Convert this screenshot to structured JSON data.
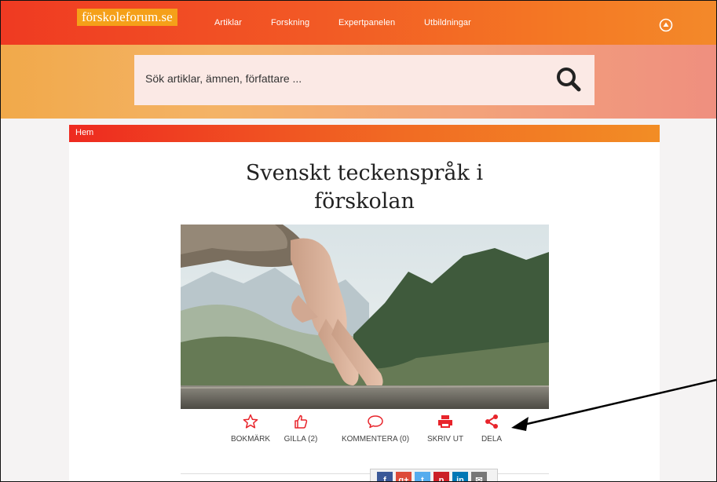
{
  "header": {
    "logo": "förskoleforum.se",
    "nav": [
      "Artiklar",
      "Forskning",
      "Expertpanelen",
      "Utbildningar"
    ]
  },
  "search": {
    "placeholder": "Sök artiklar, ämnen, författare ..."
  },
  "breadcrumb": "Hem",
  "article": {
    "title_line1": "Svenskt teckenspråk i",
    "title_line2": "förskolan"
  },
  "actions": [
    {
      "label": "BOKMÄRK",
      "icon": "star-icon"
    },
    {
      "label": "GILLA (2)",
      "icon": "thumbs-up-icon"
    },
    {
      "label": "KOMMENTERA (0)",
      "icon": "comment-icon"
    },
    {
      "label": "SKRIV UT",
      "icon": "print-icon"
    },
    {
      "label": "DELA",
      "icon": "share-icon"
    }
  ],
  "share_buttons": [
    {
      "label": "f",
      "icon": "facebook-icon",
      "color": "#3b5998"
    },
    {
      "label": "g+",
      "icon": "google-plus-icon",
      "color": "#dd4b39"
    },
    {
      "label": "t",
      "icon": "twitter-icon",
      "color": "#55acee"
    },
    {
      "label": "p",
      "icon": "pinterest-icon",
      "color": "#cb2027"
    },
    {
      "label": "in",
      "icon": "linkedin-icon",
      "color": "#0077b5"
    },
    {
      "label": "✉",
      "icon": "email-icon",
      "color": "#777777"
    }
  ],
  "colors": {
    "accent": "#e8242b",
    "header_orange": "#f47a24",
    "logo_bg": "#f5a019"
  }
}
